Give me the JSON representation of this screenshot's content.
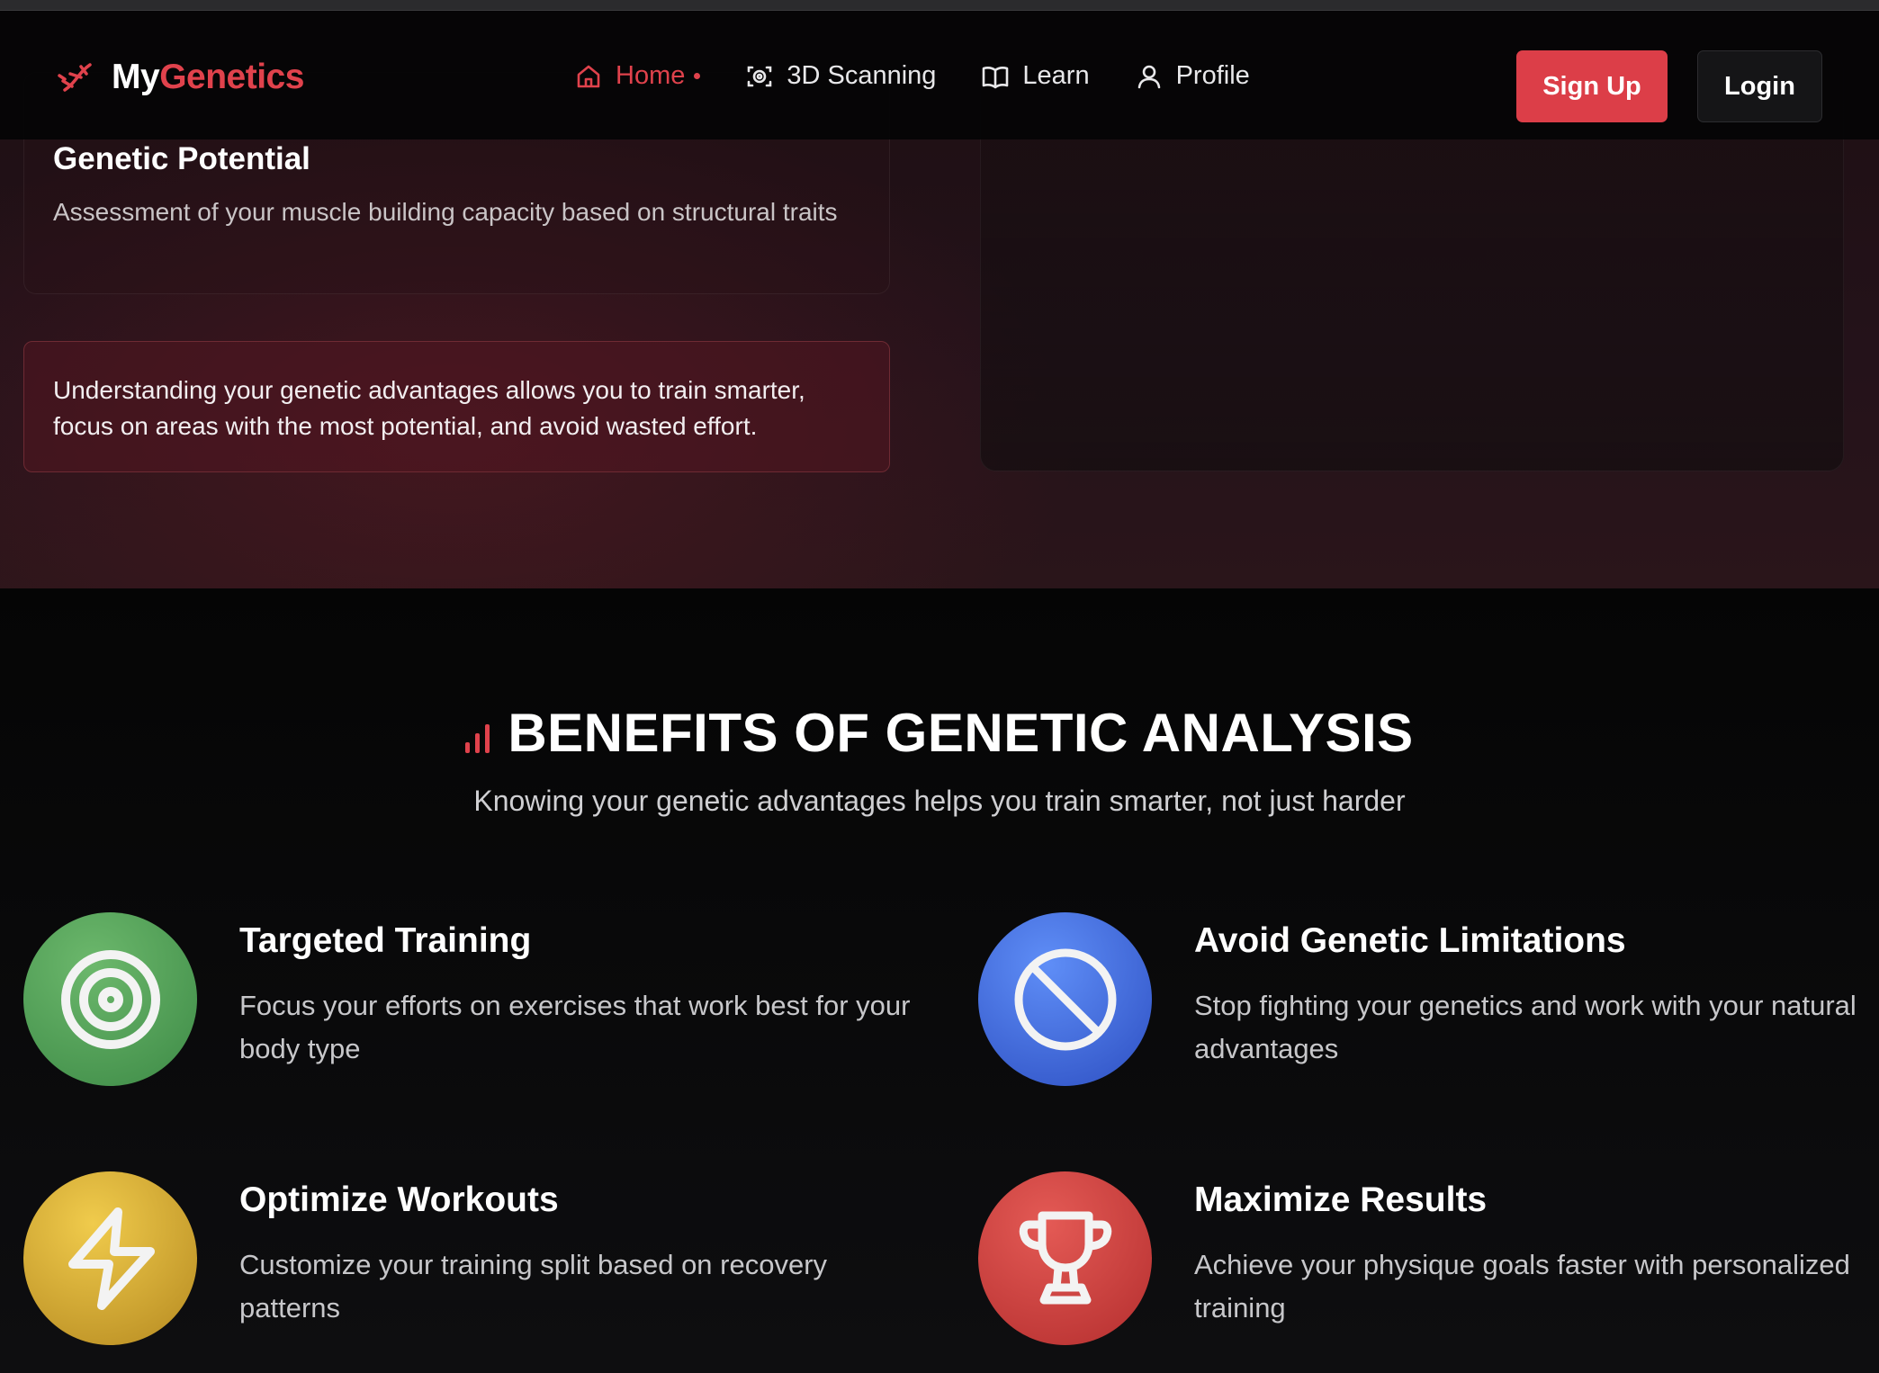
{
  "app": {
    "logo_my": "My",
    "logo_genetics": "Genetics"
  },
  "nav": {
    "items": [
      {
        "label": "Home",
        "icon": "home-icon",
        "active": true
      },
      {
        "label": "3D Scanning",
        "icon": "scan-icon",
        "active": false
      },
      {
        "label": "Learn",
        "icon": "book-icon",
        "active": false
      },
      {
        "label": "Profile",
        "icon": "user-icon",
        "active": false
      }
    ],
    "signup_label": "Sign Up",
    "login_label": "Login"
  },
  "upper": {
    "card_title": "Genetic Potential",
    "card_desc": "Assessment of your muscle building capacity based on structural traits",
    "note": "Understanding your genetic advantages allows you to train smarter, focus on areas with the most potential, and avoid wasted effort."
  },
  "benefits": {
    "title": "BENEFITS OF GENETIC ANALYSIS",
    "subtitle": "Knowing your genetic advantages helps you train smarter, not just harder",
    "items": [
      {
        "title": "Targeted Training",
        "desc": "Focus your efforts on exercises that work best for your body type",
        "icon": "target-icon",
        "color": "#4f9f56"
      },
      {
        "title": "Avoid Genetic Limitations",
        "desc": "Stop fighting your genetics and work with your natural advantages",
        "icon": "ban-icon",
        "color": "#3b63dc"
      },
      {
        "title": "Optimize Workouts",
        "desc": "Customize your training split based on recovery patterns",
        "icon": "lightning-icon",
        "color": "#d8aa34"
      },
      {
        "title": "Maximize Results",
        "desc": "Achieve your physique goals faster with personalized training",
        "icon": "trophy-icon",
        "color": "#cb3f3d"
      }
    ]
  },
  "colors": {
    "accent": "#e0424c",
    "background": "#0b0b0c"
  }
}
